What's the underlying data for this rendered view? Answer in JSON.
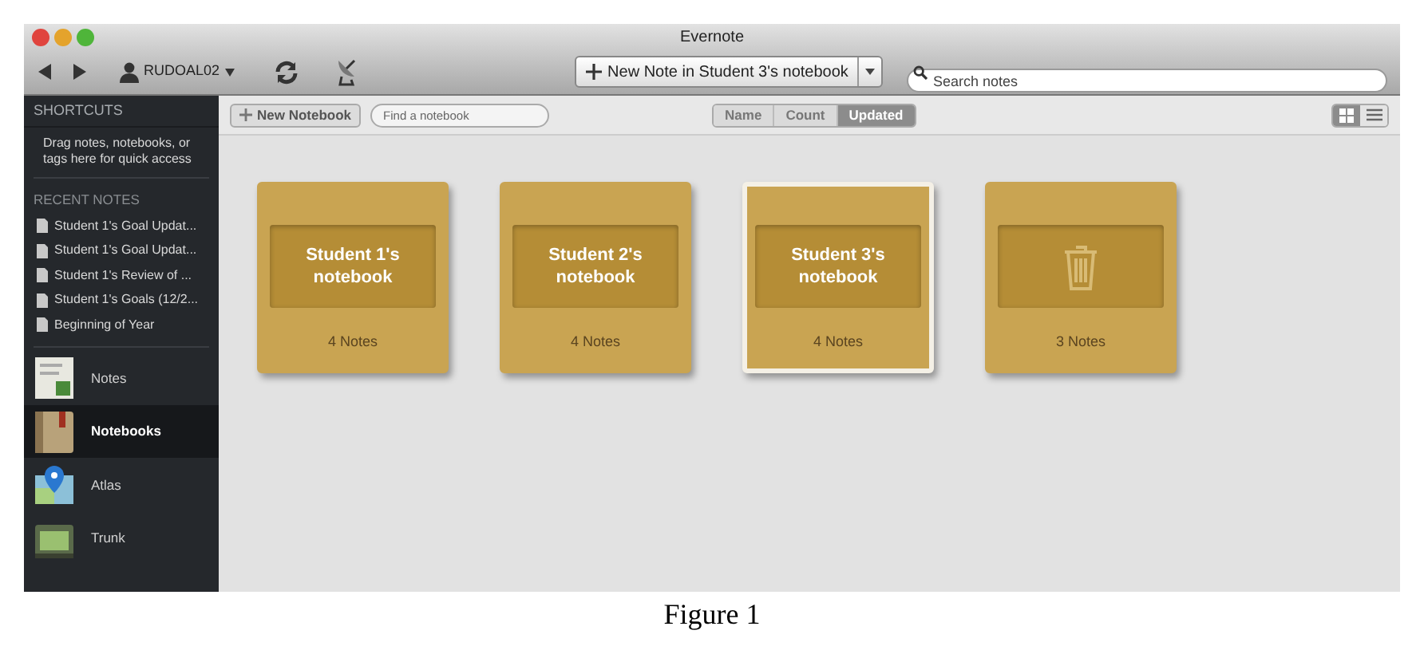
{
  "window": {
    "title": "Evernote"
  },
  "toolbar": {
    "account": "RUDOAL02",
    "new_note": "New Note in Student 3's notebook",
    "search": {
      "placeholder": "Search notes"
    }
  },
  "sidebar": {
    "shortcuts_heading": "SHORTCUTS",
    "shortcuts_hint": "Drag notes, notebooks, or tags here for quick access",
    "recent_heading": "RECENT NOTES",
    "recent_notes": [
      "Student 1's Goal Updat...",
      "Student 1's Goal Updat...",
      "Student 1's Review of ...",
      "Student 1's Goals (12/2...",
      "Beginning of Year"
    ],
    "nav": [
      {
        "label": "Notes",
        "kind": "notes",
        "selected": false
      },
      {
        "label": "Notebooks",
        "kind": "notebooks",
        "selected": true
      },
      {
        "label": "Atlas",
        "kind": "atlas",
        "selected": false
      },
      {
        "label": "Trunk",
        "kind": "trunk",
        "selected": false
      }
    ]
  },
  "content_bar": {
    "new_notebook": "New Notebook",
    "find": {
      "placeholder": "Find a notebook"
    },
    "sort": [
      {
        "label": "Name",
        "selected": false
      },
      {
        "label": "Count",
        "selected": false
      },
      {
        "label": "Updated",
        "selected": true
      }
    ],
    "views": [
      {
        "kind": "grid",
        "selected": true
      },
      {
        "kind": "list",
        "selected": false
      }
    ]
  },
  "notebooks": [
    {
      "kind": "notebook",
      "title": "Student 1's notebook",
      "count": "4 Notes",
      "selected": false
    },
    {
      "kind": "notebook",
      "title": "Student 2's notebook",
      "count": "4 Notes",
      "selected": false
    },
    {
      "kind": "notebook",
      "title": "Student 3's notebook",
      "count": "4 Notes",
      "selected": true
    },
    {
      "kind": "trash",
      "count": "3 Notes",
      "selected": false
    }
  ],
  "caption": "Figure 1"
}
